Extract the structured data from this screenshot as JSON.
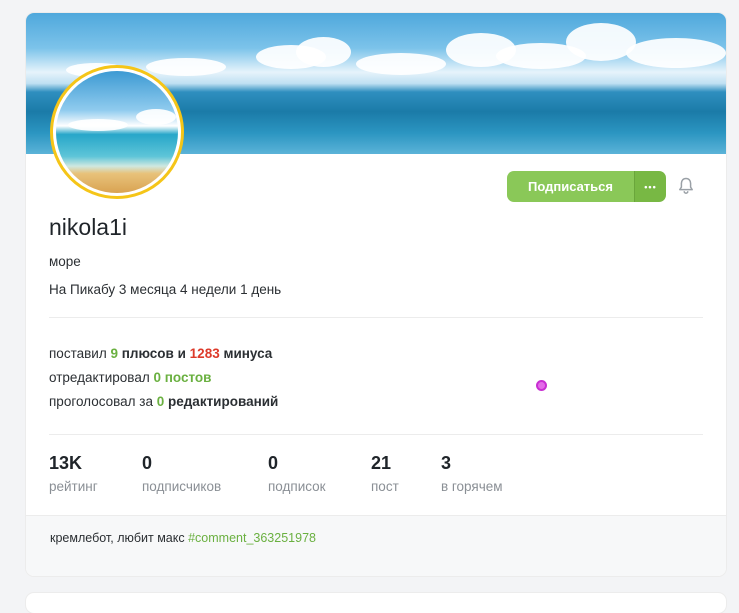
{
  "profile": {
    "username": "nikola1i",
    "bio": "море",
    "since_prefix": "На Пикабу ",
    "since_months_num": "3",
    "since_months_word": " месяца ",
    "since_weeks_num": "4",
    "since_weeks_word": " недели ",
    "since_days_num": "1",
    "since_days_word": " день"
  },
  "actions": {
    "subscribe_label": "Подписаться",
    "more_label": "•••",
    "bell_icon": "bell-icon",
    "accent": "#8ac858"
  },
  "activity": {
    "line1_prefix": "поставил ",
    "pluses_count": "9",
    "pluses_word": " плюсов",
    "and_word": " и ",
    "minuses_count": "1283",
    "minuses_word": " минуса",
    "line2_prefix": "отредактировал ",
    "edited_count": "0",
    "edited_word": " постов",
    "line3_prefix": "проголосовал за ",
    "voted_count": "0",
    "voted_word": " редактирований",
    "plus_color": "#6ab040",
    "minus_color": "#dd3a2a"
  },
  "counters": [
    {
      "value": "13K",
      "label": "рейтинг"
    },
    {
      "value": "0",
      "label": "подписчиков"
    },
    {
      "value": "0",
      "label": "подписок"
    },
    {
      "value": "21",
      "label": "пост"
    },
    {
      "value": "3",
      "label": "в горячем"
    }
  ],
  "footer": {
    "note": "кремлебот, любит макс ",
    "tag": "#comment_363251978"
  }
}
